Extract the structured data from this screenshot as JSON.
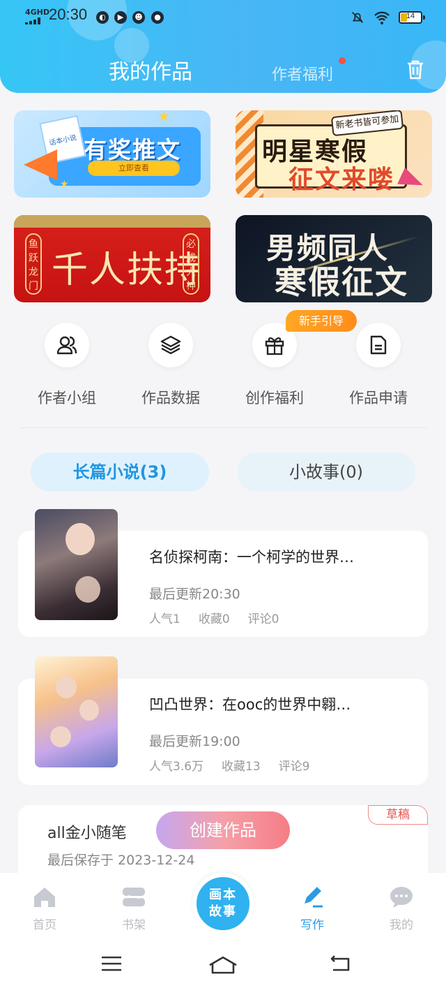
{
  "status_bar": {
    "network": "4GHD",
    "time": "20:30",
    "battery": "14"
  },
  "header": {
    "title": "我的作品",
    "welfare_tab": "作者福利"
  },
  "banners": [
    {
      "title": "有奖推文",
      "button": "立即查看",
      "paper_text": "话本小说"
    },
    {
      "title_line1": "明星寒假",
      "title_line2": "征文来喽",
      "tag": "新老书皆可参加"
    },
    {
      "title": "千人扶持",
      "left_vertical": "鱼跃龙门",
      "right_vertical": "必成大神"
    },
    {
      "title_line1": "男频同人",
      "title_line2": "寒假征文"
    }
  ],
  "quick_actions": [
    {
      "label": "作者小组",
      "icon": "group-icon"
    },
    {
      "label": "作品数据",
      "icon": "layers-icon"
    },
    {
      "label": "创作福利",
      "icon": "gift-icon"
    },
    {
      "label": "作品申请",
      "icon": "document-icon"
    }
  ],
  "guide_badge": "新手引导",
  "segments": {
    "long": "长篇小说(3)",
    "short": "小故事(0)"
  },
  "works": [
    {
      "title": "名侦探柯南：一个柯学的世界…",
      "update": "最后更新20:30",
      "popularity": "人气1",
      "favorites": "收藏0",
      "comments": "评论0"
    },
    {
      "title": "凹凸世界：在ooc的世界中翱…",
      "update": "最后更新19:00",
      "popularity": "人气3.6万",
      "favorites": "收藏13",
      "comments": "评论9"
    }
  ],
  "draft": {
    "tag": "草稿",
    "title": "all金小随笔",
    "saved": "最后保存于 2023-12-24"
  },
  "create_button": "创建作品",
  "bottom_nav": {
    "home": "首页",
    "shelf": "书架",
    "center": "画本故事",
    "center_line1": "画本",
    "center_line2": "故事",
    "write": "写作",
    "mine": "我的"
  },
  "colors": {
    "accent": "#2d9be3",
    "header": "#49b6f5",
    "badge_orange": "#ff8c1a",
    "draft_red": "#e4574f"
  }
}
